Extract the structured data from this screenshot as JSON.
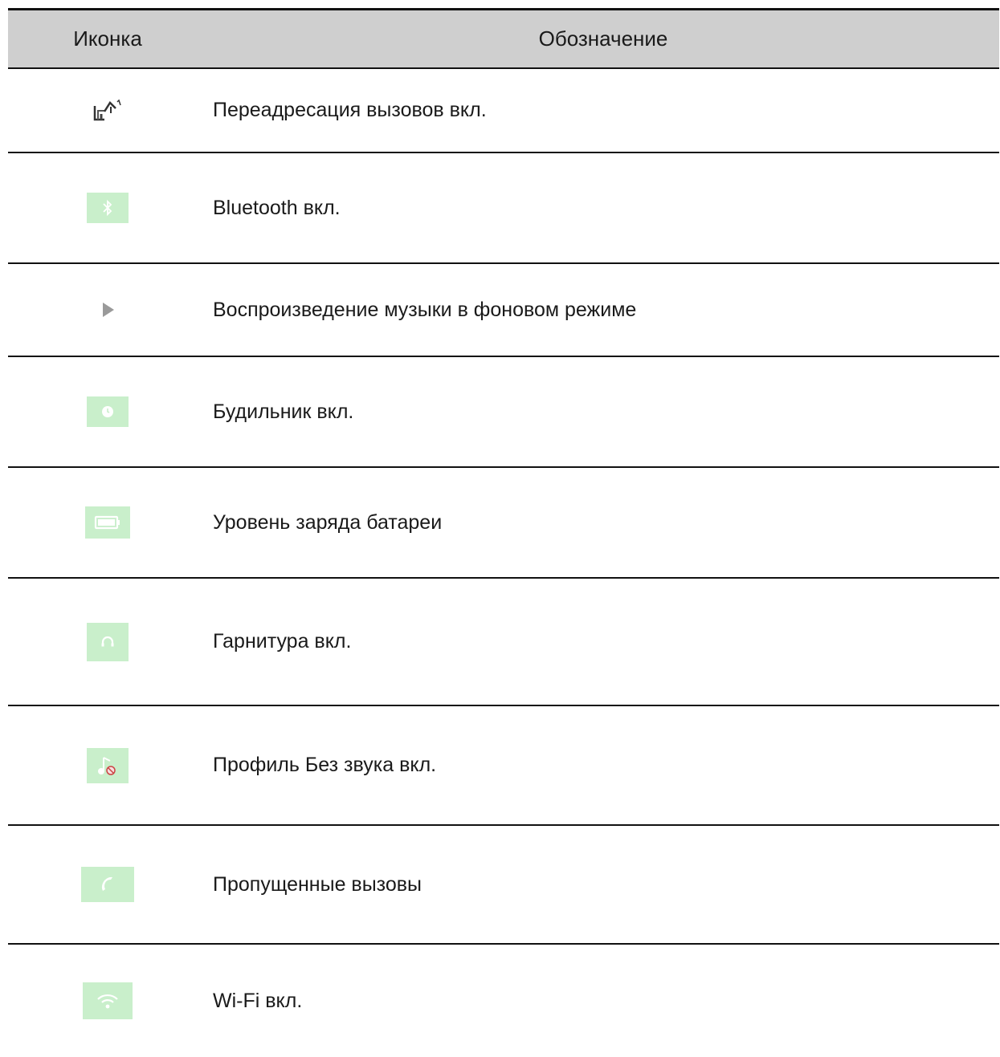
{
  "table": {
    "header": {
      "icon_col": "Иконка",
      "meaning_col": "Обозначение"
    },
    "rows": [
      {
        "icon": "call-forward-icon",
        "label": "Переадресация вызовов вкл."
      },
      {
        "icon": "bluetooth-icon",
        "label": "Bluetooth вкл."
      },
      {
        "icon": "play-icon",
        "label": "Воспроизведение музыки в фоновом режиме"
      },
      {
        "icon": "alarm-clock-icon",
        "label": "Будильник вкл."
      },
      {
        "icon": "battery-icon",
        "label": "Уровень заряда батареи"
      },
      {
        "icon": "headset-icon",
        "label": "Гарнитура вкл."
      },
      {
        "icon": "silent-profile-icon",
        "label": "Профиль Без звука вкл."
      },
      {
        "icon": "missed-call-icon",
        "label": "Пропущенные вызовы"
      },
      {
        "icon": "wifi-icon",
        "label": "Wi-Fi вкл."
      }
    ]
  },
  "colors": {
    "header_bg": "#cfcfcf",
    "icon_bg": "#c9efcb",
    "rule": "#111111"
  }
}
